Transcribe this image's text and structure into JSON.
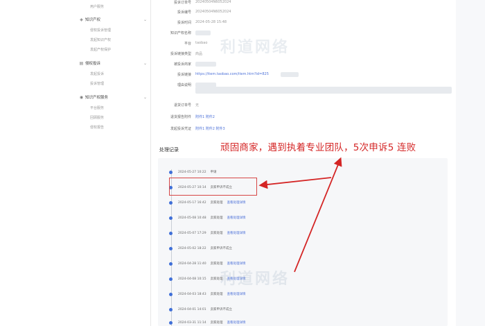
{
  "sidebar": {
    "top_item": "用户服务",
    "groups": [
      {
        "label": "知识产权",
        "items": [
          "侵权投诉管理",
          "发起知识产权",
          "发起产权保护"
        ]
      },
      {
        "label": "侵权投诉",
        "items": [
          "发起投诉",
          "投诉管理"
        ]
      },
      {
        "label": "知识产权服务",
        "items": [
          "平台服务",
          "回顾服务",
          "侵权报告"
        ]
      }
    ]
  },
  "detail": {
    "fields": [
      {
        "label": "投诉订单号",
        "value": "20240504N6052024"
      },
      {
        "label": "投诉编号",
        "value": "20240504N6052024"
      },
      {
        "label": "投诉时间",
        "value": "2024-05-28 15:48"
      },
      {
        "label": "知识产权名称",
        "value": ""
      },
      {
        "label": "平台",
        "value": "taobao"
      },
      {
        "label": "投诉链接类型",
        "value": "商品"
      },
      {
        "label": "被投诉商家",
        "value": ""
      },
      {
        "label": "投诉链接",
        "value": "https://item.taobao.com/item.htm?id=825"
      },
      {
        "label": "理由说明",
        "value": ""
      },
      {
        "label": "退货订单号",
        "value": "无"
      },
      {
        "label": "退货报告附件",
        "value": "附件1 附件2"
      },
      {
        "label": "发起投诉凭证",
        "value": "附件1 附件2 附件3"
      }
    ]
  },
  "records": {
    "title": "处理记录",
    "entries": [
      {
        "time": "2024-05-27 10:22",
        "status": "申请",
        "link": ""
      },
      {
        "time": "2024-05-27 10:14",
        "status": "卖家申诉不成立",
        "link": ""
      },
      {
        "time": "2024-05-17 16:42",
        "status": "卖家处理",
        "link": "查看处理详情"
      },
      {
        "time": "2024-05-08 10:48",
        "status": "卖家处理",
        "link": "查看处理详情"
      },
      {
        "time": "2024-05-07 17:29",
        "status": "卖家处理",
        "link": "查看处理详情"
      },
      {
        "time": "2024-05-02 18:22",
        "status": "卖家申诉不成立",
        "link": ""
      },
      {
        "time": "2024-04-28 11:40",
        "status": "卖家处理",
        "link": "查看处理详情"
      },
      {
        "time": "2024-04-08 10:15",
        "status": "卖家处理",
        "link": "查看处理详情"
      },
      {
        "time": "2024-04-03 18:43",
        "status": "卖家处理",
        "link": "查看处理详情"
      },
      {
        "time": "2024-04-01 14:01",
        "status": "卖家申诉不成立",
        "link": ""
      },
      {
        "time": "2024-03-31 11:14",
        "status": "卖家处理",
        "link": "查看处理详情"
      }
    ]
  },
  "annotation": {
    "text": "顽固商家，遇到执着专业团队，5次申诉5 连败",
    "color": "#d42525"
  },
  "watermark": "利道网络",
  "colors": {
    "accent": "#3f6fd8",
    "link": "#4f73d9",
    "annotation": "#d42525"
  }
}
